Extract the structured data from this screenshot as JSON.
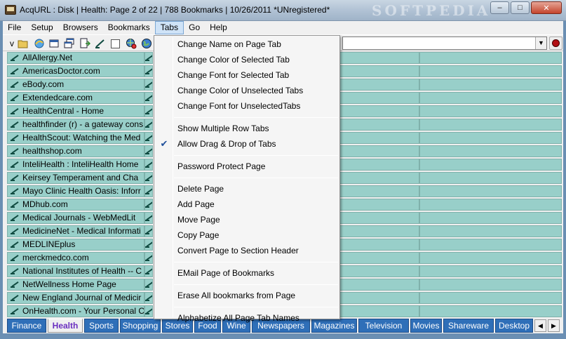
{
  "window": {
    "title": "AcqURL : Disk  |  Health: Page 2 of 22  |  788 Bookmarks  |  10/26/2011   *UNregistered*",
    "watermark": "SOFTPEDIA",
    "minimize": "–",
    "maximize": "□",
    "close": "✕"
  },
  "menubar": [
    "File",
    "Setup",
    "Browsers",
    "Bookmarks",
    "Tabs",
    "Go",
    "Help"
  ],
  "toolbar": {
    "v_label": "v",
    "icons": [
      "open-folder-icon",
      "browser-icon",
      "windows-icon",
      "windows-stack-icon",
      "export-icon",
      "bookmark-pen-icon",
      "checkbox-icon",
      "globe-search-icon",
      "globe-icon"
    ],
    "combo_value": "",
    "combo_arrow": "▼",
    "record_color": "#b20f14"
  },
  "bookmarks": [
    "AllAllergy.Net",
    "AmericasDoctor.com",
    "eBody.com",
    "Extendedcare.com",
    "HealthCentral - Home",
    "healthfinder (r) - a gateway cons",
    "HealthScout: Watching the Med",
    "healthshop.com",
    "InteliHealth : InteliHealth Home",
    "Keirsey Temperament and Cha",
    "Mayo Clinic Health Oasis: Inforr",
    "MDhub.com",
    "Medical Journals - WebMedLit",
    "MedicineNet - Medical Informati",
    "MEDLINEplus",
    "merckmedco.com",
    "National Institutes of Health -- C",
    "NetWellness Home Page",
    "New England Journal of Medicir",
    "OnHealth.com - Your Personal C"
  ],
  "tabs_menu": {
    "items": [
      {
        "label": "Change Name on Page Tab",
        "checked": false
      },
      {
        "label": "Change Color of Selected Tab",
        "checked": false
      },
      {
        "label": "Change Font for Selected Tab",
        "checked": false
      },
      {
        "label": "Change Color of Unselected Tabs",
        "checked": false
      },
      {
        "label": "Change Font for UnselectedTabs",
        "checked": false
      },
      {
        "separator": true
      },
      {
        "label": "Show Multiple Row Tabs",
        "checked": false
      },
      {
        "label": "Allow Drag & Drop of Tabs",
        "checked": true
      },
      {
        "separator": true
      },
      {
        "label": "Password Protect Page",
        "checked": false
      },
      {
        "separator": true
      },
      {
        "label": "Delete Page",
        "checked": false
      },
      {
        "label": "Add Page",
        "checked": false
      },
      {
        "label": "Move Page",
        "checked": false
      },
      {
        "label": "Copy Page",
        "checked": false
      },
      {
        "label": "Convert Page to Section Header",
        "checked": false
      },
      {
        "separator": true
      },
      {
        "label": "EMail Page of Bookmarks",
        "checked": false
      },
      {
        "separator": true
      },
      {
        "label": "Erase All bookmarks from Page",
        "checked": false
      },
      {
        "separator": true
      },
      {
        "label": "Alphabetize All Page Tab Names",
        "checked": false
      }
    ],
    "check_mark": "✔"
  },
  "page_tabs": {
    "active": "Health",
    "items": [
      "Finance",
      "Health",
      "Sports",
      "Shopping",
      "Stores",
      "Food",
      "Wine",
      "Newspapers",
      "Magazines",
      "Television",
      "Movies",
      "Shareware",
      "Desktop"
    ],
    "scroll_left": "◀",
    "scroll_right": "▶"
  },
  "colors": {
    "cell": "#98cfc9",
    "tab": "#2f6fb8",
    "active_tab_text": "#6a2fc0"
  }
}
